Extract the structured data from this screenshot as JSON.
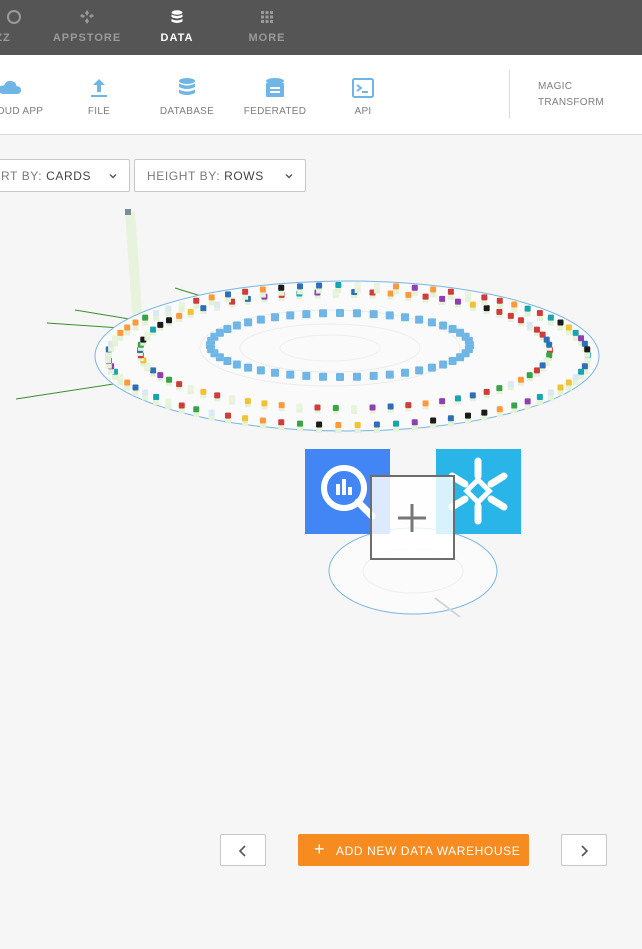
{
  "topnav": {
    "items": [
      {
        "label": "ZZ",
        "icon": "buzz-icon"
      },
      {
        "label": "APPSTORE",
        "icon": "appstore-icon"
      },
      {
        "label": "DATA",
        "icon": "database-icon",
        "active": true
      },
      {
        "label": "MORE",
        "icon": "grid-icon"
      }
    ]
  },
  "toolbar": {
    "items": [
      {
        "label": "OUD APP",
        "icon": "cloud-icon"
      },
      {
        "label": "FILE",
        "icon": "upload-icon"
      },
      {
        "label": "DATABASE",
        "icon": "database-icon"
      },
      {
        "label": "FEDERATED",
        "icon": "federated-icon"
      },
      {
        "label": "API",
        "icon": "terminal-icon"
      }
    ],
    "magic_transform": [
      "MAGIC",
      "TRANSFORM"
    ]
  },
  "controls": {
    "sort_prefix": "RT BY:",
    "sort_value": "CARDS",
    "height_prefix": "HEIGHT BY:",
    "height_value": "ROWS"
  },
  "warehouses": [
    {
      "name": "bigquery-logo",
      "color": "#4285f4"
    },
    {
      "name": "snowflake-logo",
      "color": "#29b5e8"
    }
  ],
  "actions": {
    "add_warehouse": "ADD NEW DATA WAREHOUSE"
  },
  "colors": {
    "accent": "#f68b1f",
    "nav_bg": "#555555",
    "ring": "#76b7e6"
  }
}
